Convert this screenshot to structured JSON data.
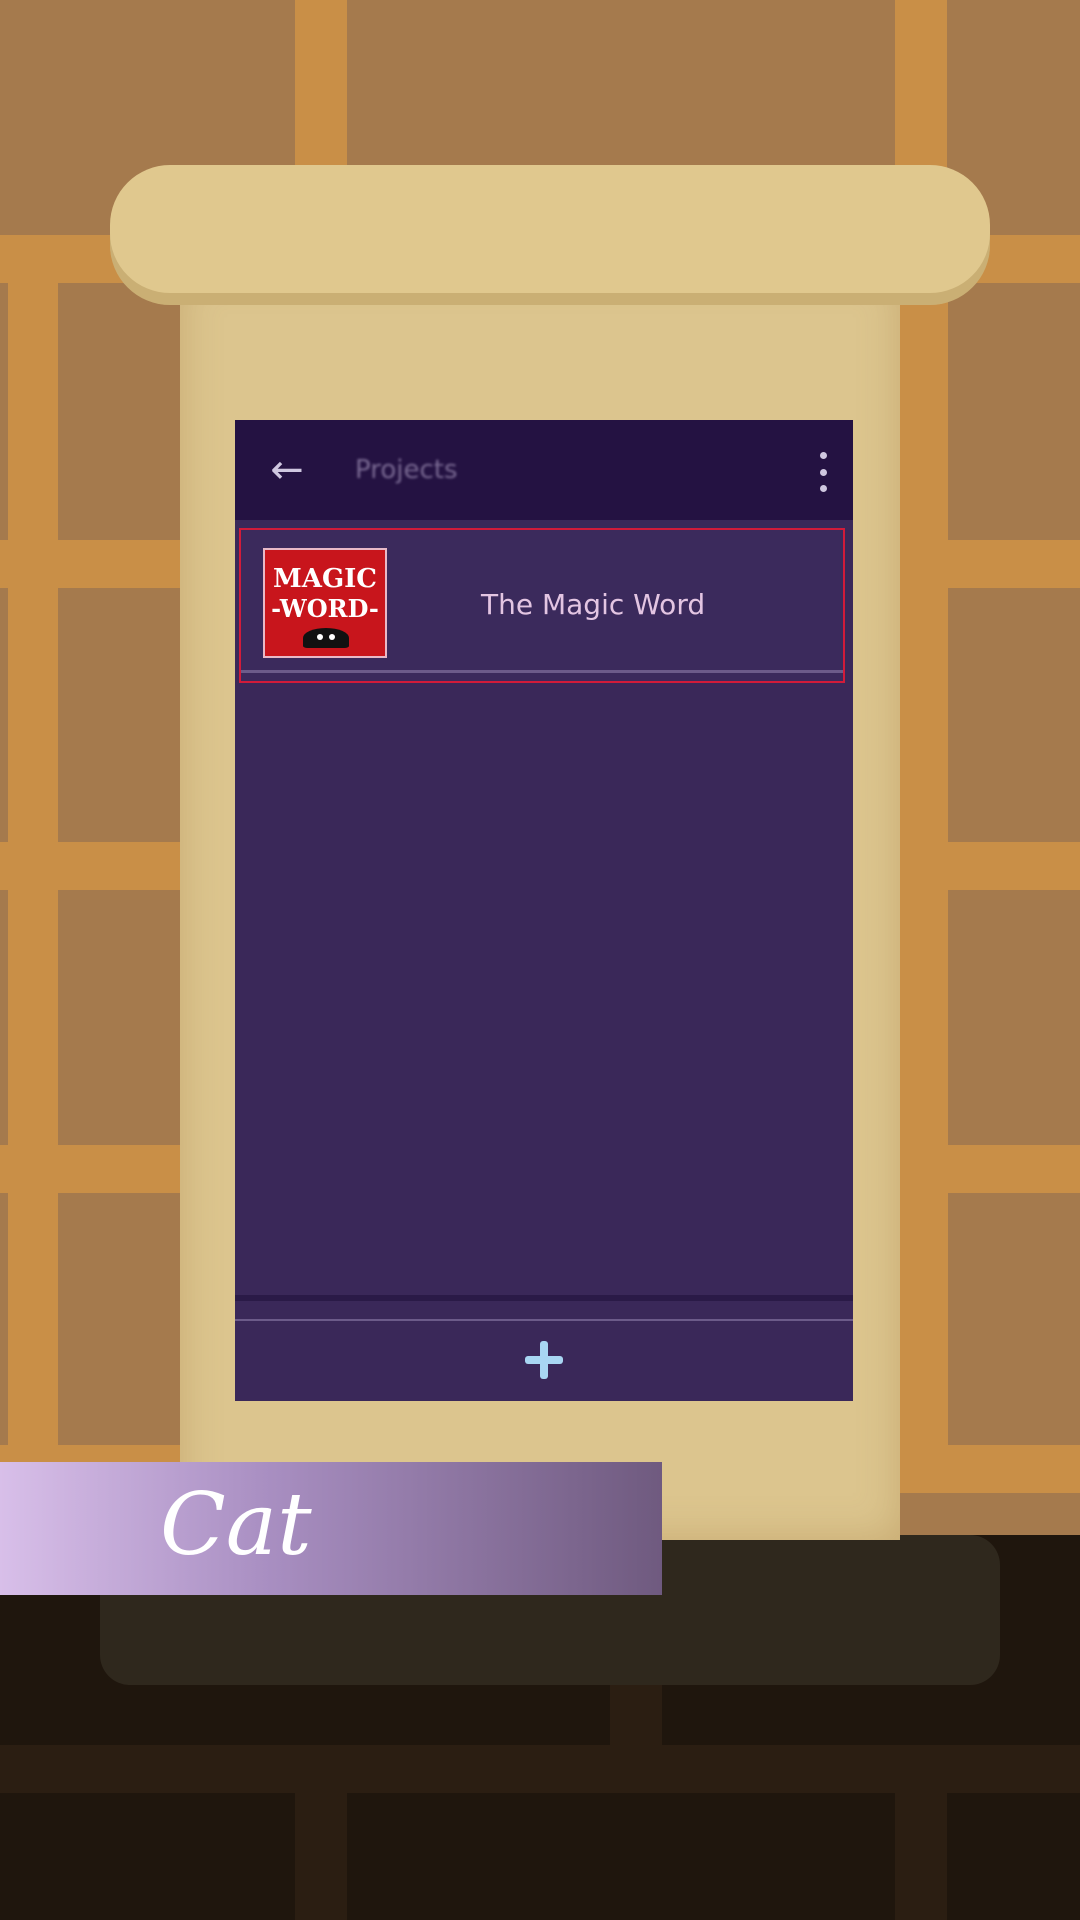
{
  "app": {
    "appbar": {
      "title": "Projects"
    },
    "list": [
      {
        "title": "The Magic Word",
        "thumbnail_text": {
          "line1": "MAGIC",
          "line2": "-WORD-"
        }
      }
    ]
  },
  "character": {
    "name": "Cat"
  },
  "colors": {
    "appbar_bg": "#241242",
    "list_bg": "#3a2859",
    "highlight_border": "#d11b3a",
    "item_title": "#e3c5e2",
    "add_icon": "#a8d6f2"
  },
  "icons": {
    "back": "arrow-left-icon",
    "more": "more-vertical-icon",
    "add": "plus-icon"
  }
}
